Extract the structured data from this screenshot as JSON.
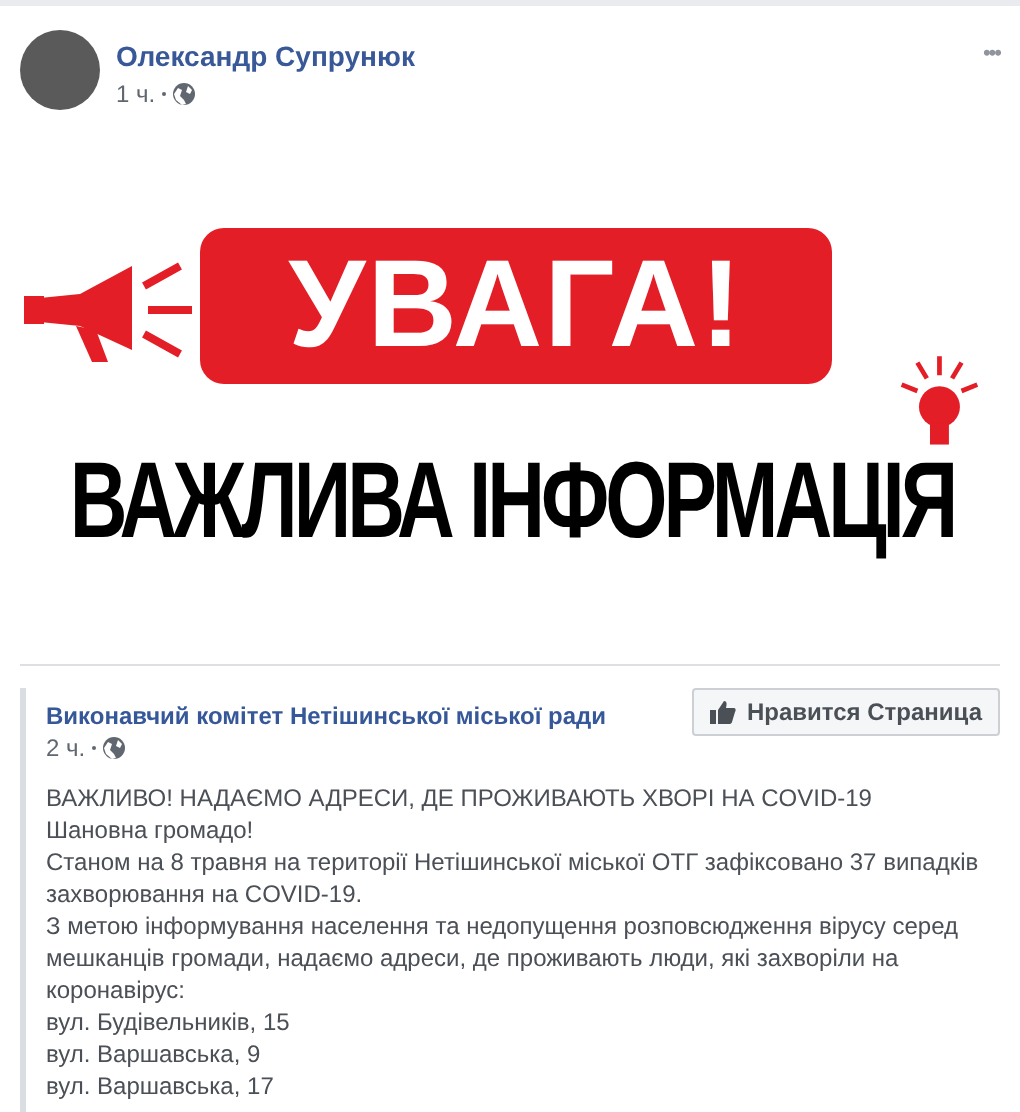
{
  "post": {
    "author": "Олександр Супрунюк",
    "time": "1 ч.",
    "more": "•••"
  },
  "image": {
    "badge": "УВАГА!",
    "headline": "ВАЖЛИВА ІНФОРМАЦІЯ"
  },
  "shared_post": {
    "author": "Виконавчий комітет Нетішинської міської ради",
    "time": "2 ч.",
    "like_button": "Нравится Страница",
    "lines": [
      "ВАЖЛИВО! НАДАЄМО АДРЕСИ, ДЕ ПРОЖИВАЮТЬ ХВОРІ НА COVID-19",
      "Шановна громадо!",
      "Станом на 8 травня на території Нетішинської міської ОТГ зафіксовано 37 випадків захворювання на COVID-19.",
      "З метою інформування населення та недопущення розповсюдження вірусу серед мешканців громади, надаємо адреси, де проживають люди, які захворіли на коронавірус:",
      "вул. Будівельників, 15",
      "вул. Варшавська, 9",
      "вул. Варшавська, 17"
    ]
  }
}
